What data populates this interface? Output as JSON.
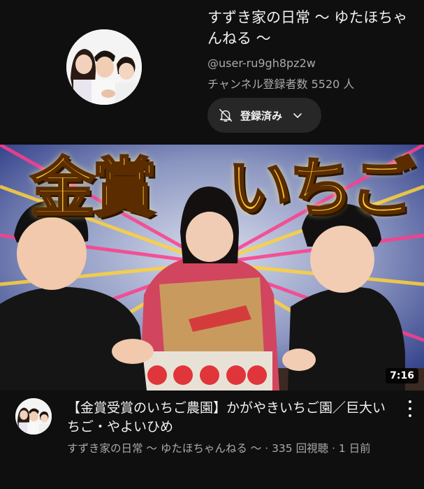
{
  "channel": {
    "title": "すずき家の日常 〜 ゆたほちゃんねる 〜",
    "handle": "@user-ru9gh8pz2w",
    "subscribers": "チャンネル登録者数 5520 人",
    "subscribe_button_label": "登録済み",
    "subscribe_icon": "bell-off-icon",
    "dropdown_icon": "chevron-down-icon"
  },
  "video": {
    "thumbnail_text_left": "金賞",
    "thumbnail_text_right": "いちご",
    "duration": "7:16",
    "title": "【金賞受賞のいちご農園】かがやきいちご園／巨大いちご・やよいひめ",
    "byline": "すずき家の日常 〜 ゆたほちゃんねる 〜 · 335 回視聴 · 1 日前",
    "menu_icon": "more-vertical-icon"
  },
  "colors": {
    "background": "#0f0f0f",
    "button_background": "#272727",
    "primary_text": "#f1f1f1",
    "secondary_text": "#aaaaaa",
    "thumbnail_title": "#f7c531"
  }
}
